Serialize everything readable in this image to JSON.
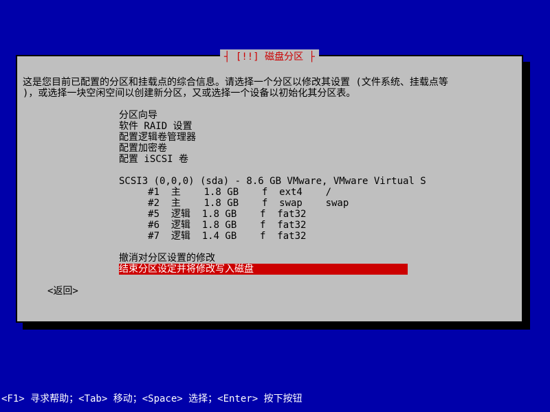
{
  "dialog": {
    "title": "┤ [!!] 磁盘分区 ├",
    "description": "这是您目前已配置的分区和挂载点的综合信息。请选择一个分区以修改其设置 (文件系统、挂载点等\n)，或选择一块空闲空间以创建新分区，又或选择一个设备以初始化其分区表。"
  },
  "menu": {
    "items": [
      "分区向导",
      "软件 RAID 设置",
      "配置逻辑卷管理器",
      "配置加密卷",
      "配置 iSCSI 卷"
    ]
  },
  "disk": {
    "header": "SCSI3 (0,0,0) (sda) - 8.6 GB VMware, VMware Virtual S",
    "partitions": [
      "     #1  主    1.8 GB    f  ext4    /",
      "     #2  主    1.8 GB    f  swap    swap",
      "     #5  逻辑  1.8 GB    f  fat32",
      "     #6  逻辑  1.8 GB    f  fat32",
      "     #7  逻辑  1.4 GB    f  fat32"
    ]
  },
  "bottom": {
    "undo": "撤消对分区设置的修改",
    "finish": "结束分区设定并将修改写入磁盘"
  },
  "back": "<返回>",
  "footer": "<F1> 寻求帮助；<Tab> 移动；<Space> 选择；<Enter> 按下按钮"
}
